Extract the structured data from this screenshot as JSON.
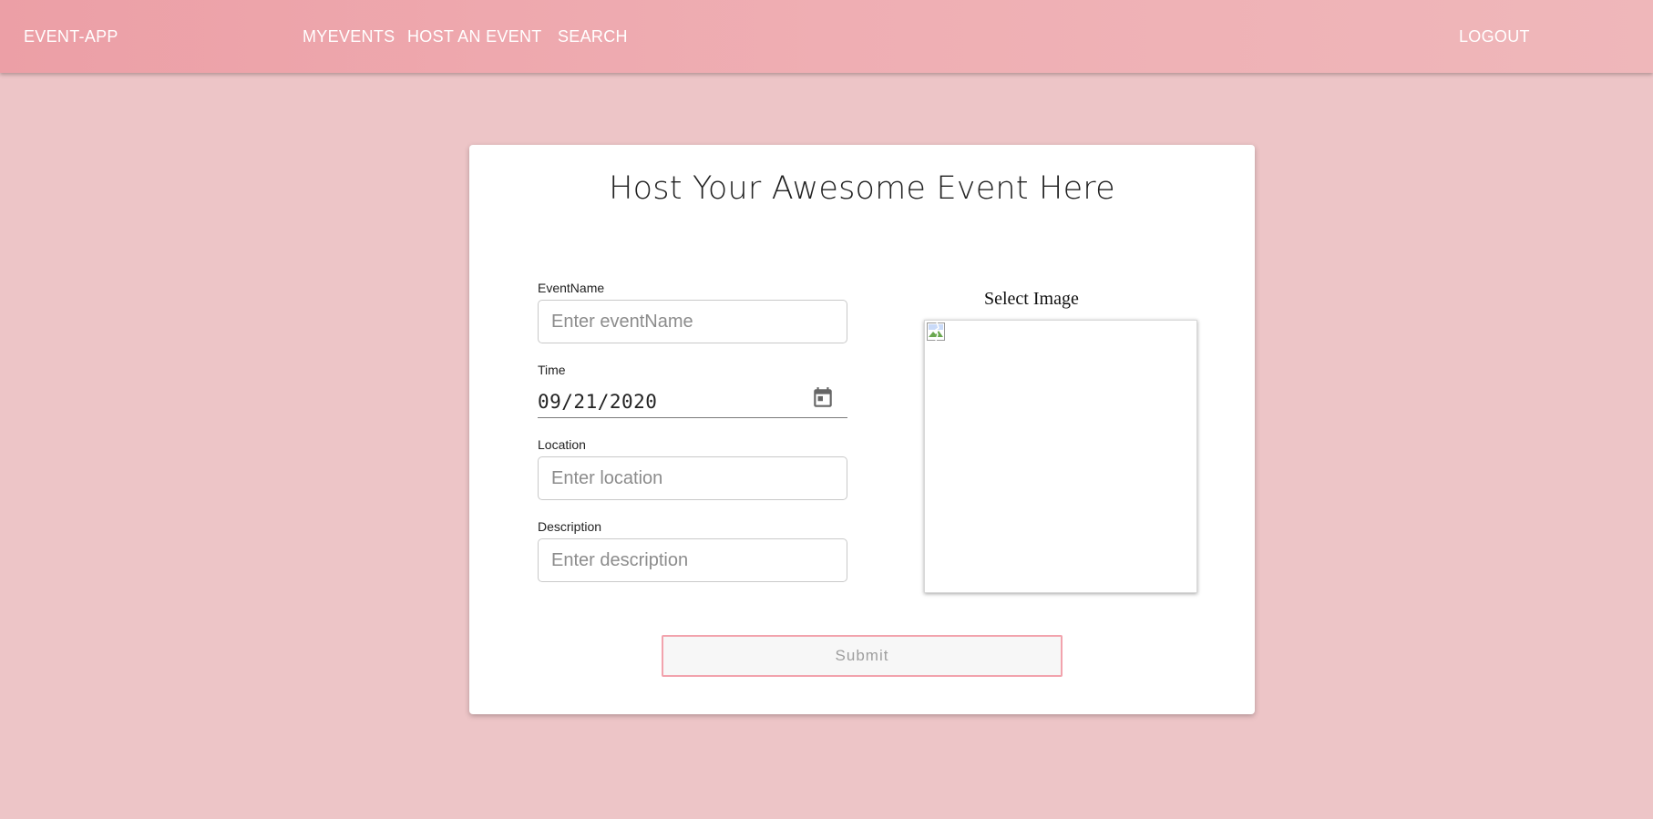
{
  "navbar": {
    "brand": "EVENT-APP",
    "links": [
      {
        "label": "MYEVENTS"
      },
      {
        "label": "HOST AN EVENT"
      },
      {
        "label": "SEARCH"
      }
    ],
    "logout": "LOGOUT"
  },
  "form": {
    "title": "Host Your Awesome Event Here",
    "event_name": {
      "label": "EventName",
      "placeholder": "Enter eventName",
      "value": ""
    },
    "time": {
      "label": "Time",
      "value": "09/21/2020",
      "icon": "calendar-icon"
    },
    "location": {
      "label": "Location",
      "placeholder": "Enter location",
      "value": ""
    },
    "description": {
      "label": "Description",
      "placeholder": "Enter description",
      "value": ""
    },
    "image": {
      "label": "Select Image",
      "icon": "broken-image-icon"
    },
    "submit_label": "Submit"
  },
  "colors": {
    "page_background": "#edc5c7",
    "navbar_start": "#ec9fa6",
    "navbar_end": "#efb7ba",
    "submit_border": "#f2a3ad"
  }
}
